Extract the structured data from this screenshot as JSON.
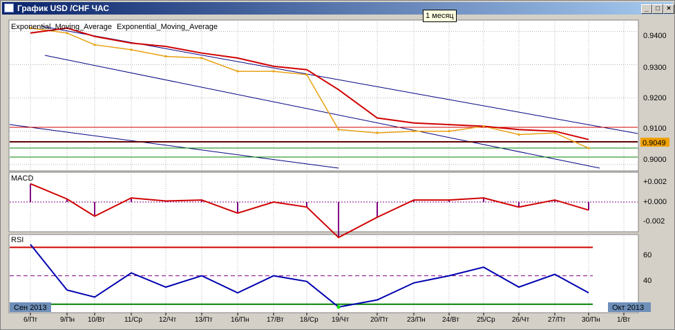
{
  "window": {
    "title": "График USD /CHF ЧАС",
    "buttons": [
      "_",
      "□",
      "×"
    ]
  },
  "tooltip": "1 месяц",
  "indicators": {
    "ema_label_1": "Exponential_Moving_Average",
    "ema_label_2": "Exponential_Moving_Average",
    "macd_label": "MACD",
    "rsi_label": "RSI"
  },
  "price_badge": "0.9049",
  "price_axis": [
    "0.9400",
    "0.9300",
    "0.9200",
    "0.9100",
    "0.9000"
  ],
  "macd_axis": [
    "+0.002",
    "+0.000",
    "-0.002"
  ],
  "rsi_axis": [
    "60",
    "40"
  ],
  "period_start": "Сен 2013",
  "period_end": "Окт 2013",
  "date_ticks": [
    "6/Пт",
    "9/Пн",
    "10/Вт",
    "11/Ср",
    "12/Чт",
    "13/Пт",
    "16/Пн",
    "17/Вт",
    "18/Ср",
    "19/Чт",
    "20/Пт",
    "23/Пн",
    "24/Вт",
    "25/Ср",
    "26/Чт",
    "27/Пт",
    "30/Пн",
    "1/Вт"
  ],
  "colors": {
    "price": "#e8a010",
    "ema_slow": "#d00000",
    "ema_fast": "#000080",
    "channel": "#000080",
    "rsi": "#0000b0",
    "rsi_low": "#00dd00",
    "level_green": "#008000"
  },
  "chart_data": {
    "type": "line",
    "x": [
      "6/Пт",
      "9/Пн",
      "10/Вт",
      "11/Ср",
      "12/Чт",
      "13/Пт",
      "16/Пн",
      "17/Вт",
      "18/Ср",
      "19/Чт",
      "20/Пт",
      "23/Пн",
      "24/Вт",
      "25/Ср",
      "26/Чт",
      "27/Пт",
      "30/Пн"
    ],
    "price_ylim": [
      0.8985,
      0.943
    ],
    "series": [
      {
        "name": "",
        "values": [
          0.941,
          0.9395,
          0.936,
          0.9345,
          0.9325,
          0.932,
          0.928,
          0.928,
          0.927,
          0.9105,
          0.9095,
          0.91,
          0.91,
          0.9115,
          0.909,
          0.9095,
          0.9049
        ]
      },
      {
        "name": "Exponential_Moving_Average",
        "values": [
          0.9395,
          0.941,
          0.9385,
          0.9365,
          0.9355,
          0.9335,
          0.932,
          0.9295,
          0.9285,
          0.9225,
          0.914,
          0.9125,
          0.912,
          0.9115,
          0.9105,
          0.91,
          0.9075
        ]
      }
    ],
    "macd": {
      "ylim": [
        -0.0028,
        0.0028
      ],
      "values": [
        0.0018,
        0.0003,
        -0.0014,
        0.0004,
        0.0001,
        0.0002,
        -0.0011,
        0.0,
        -0.0005,
        -0.0035,
        -0.0015,
        0.0002,
        0.0002,
        0.0004,
        -0.0005,
        0.0002,
        -0.0008
      ]
    },
    "rsi": {
      "ylim": [
        25,
        78
      ],
      "levels": [
        70,
        50,
        30
      ],
      "values": [
        72,
        40,
        35,
        52,
        42,
        50,
        38,
        50,
        46,
        28,
        33,
        45,
        50,
        56,
        42,
        51,
        38
      ]
    },
    "title": "",
    "xlabel": "",
    "ylabel": ""
  }
}
